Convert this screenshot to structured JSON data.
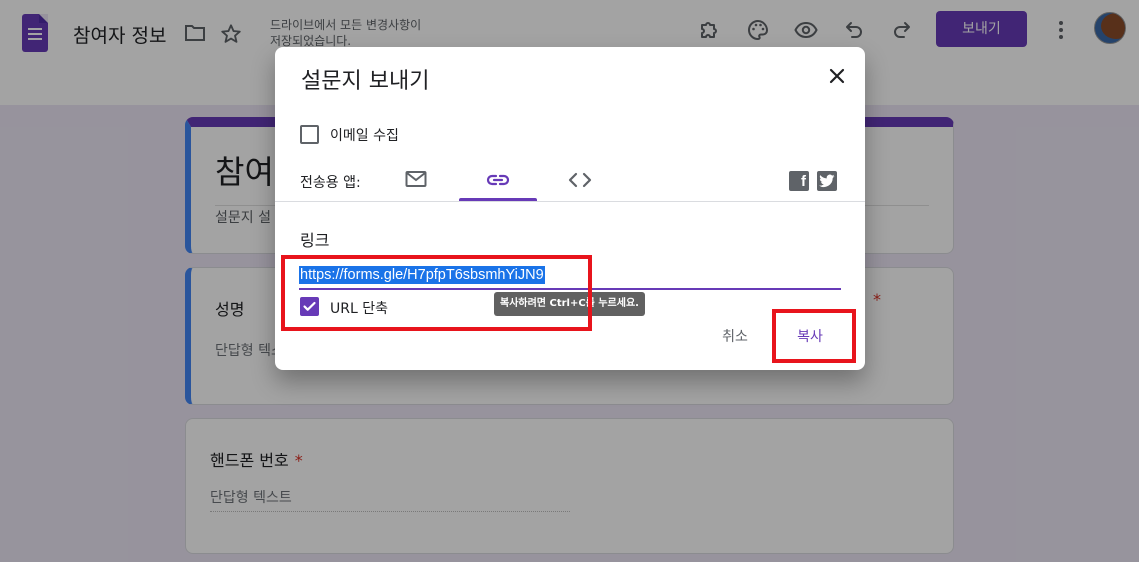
{
  "header": {
    "doc_title": "참여자 정보",
    "save_status": "드라이브에서 모든 변경사항이 저장되었습니다.",
    "send_label": "보내기",
    "icons": [
      "forms-logo-icon",
      "folder-icon",
      "star-icon",
      "addon-puzzle-icon",
      "palette-icon",
      "preview-eye-icon",
      "undo-icon",
      "redo-icon",
      "more-vert-icon"
    ]
  },
  "form": {
    "title": "참여",
    "description": "설문지 설",
    "questions": [
      {
        "label": "성명",
        "hint": "단답형 텍스트",
        "required": true
      },
      {
        "label": "핸드폰 번호",
        "required_mark": "*",
        "hint": "단답형 텍스트",
        "required": true
      }
    ]
  },
  "dialog": {
    "title": "설문지 보내기",
    "collect_email_label": "이메일 수집",
    "collect_email_checked": false,
    "send_via_label": "전송용 앱:",
    "tabs": [
      {
        "name": "email",
        "icon": "mail-icon",
        "selected": false
      },
      {
        "name": "link",
        "icon": "link-icon",
        "selected": true
      },
      {
        "name": "embed",
        "icon": "code-icon",
        "selected": false
      }
    ],
    "social": [
      "facebook-icon",
      "twitter-icon"
    ],
    "link_heading": "링크",
    "link_url": "https://forms.gle/H7pfpT6sbsmhYiJN9",
    "shorten_label": "URL 단축",
    "shorten_checked": true,
    "tooltip": "복사하려면 Ctrl+C를 누르세요.",
    "cancel_label": "취소",
    "copy_label": "복사"
  },
  "colors": {
    "accent": "#673ab7",
    "highlight": "#e8141c",
    "selection": "#1a73e8"
  }
}
